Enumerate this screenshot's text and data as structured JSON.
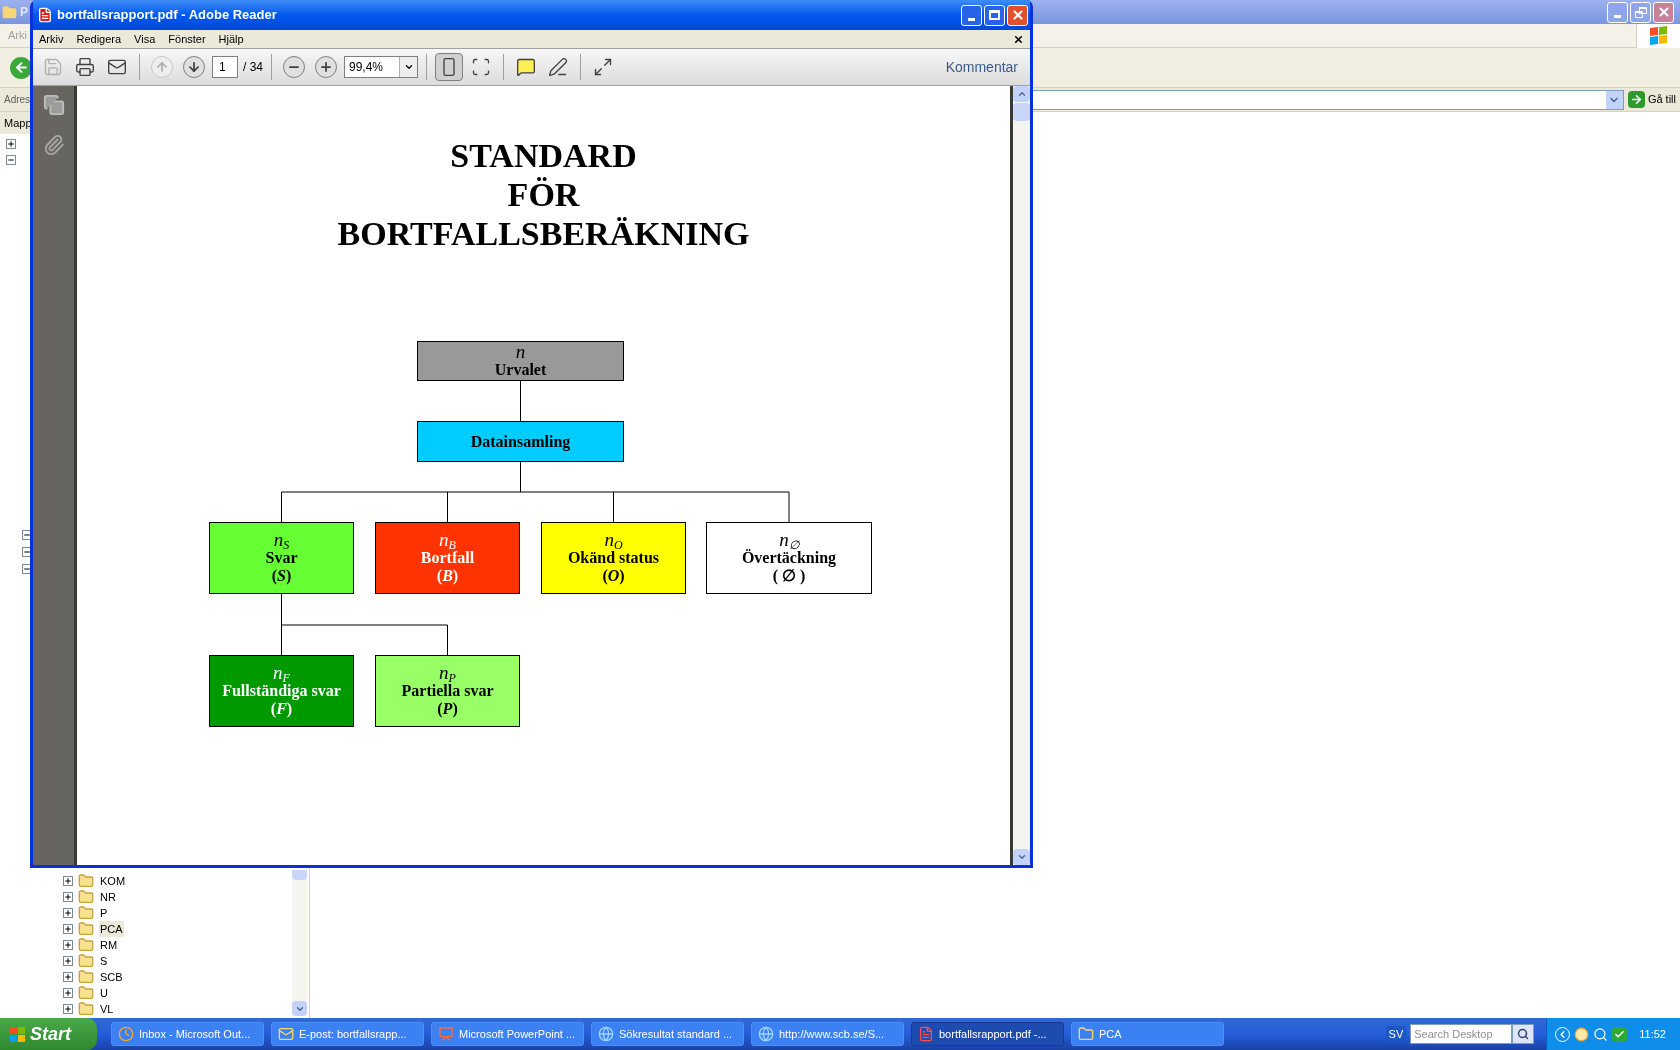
{
  "explorer": {
    "title": "P",
    "menu": [
      "Arki"
    ],
    "address_label": "Adres",
    "go_button": "Gå till",
    "folders_header": "Mapp",
    "folders": [
      {
        "name": "KOM",
        "selected": false
      },
      {
        "name": "NR",
        "selected": false
      },
      {
        "name": "P",
        "selected": false
      },
      {
        "name": "PCA",
        "selected": true
      },
      {
        "name": "RM",
        "selected": false
      },
      {
        "name": "S",
        "selected": false
      },
      {
        "name": "SCB",
        "selected": false
      },
      {
        "name": "U",
        "selected": false
      },
      {
        "name": "VL",
        "selected": false
      }
    ]
  },
  "reader": {
    "title": "bortfallsrapport.pdf - Adobe Reader",
    "menu": [
      "Arkiv",
      "Redigera",
      "Visa",
      "Fönster",
      "Hjälp"
    ],
    "tools": [
      {
        "kind": "save",
        "disabled": true,
        "pressed": false
      },
      {
        "kind": "print",
        "disabled": false,
        "pressed": false
      },
      {
        "kind": "email",
        "disabled": false,
        "pressed": false
      },
      {
        "kind": "separator"
      },
      {
        "kind": "page_up",
        "disabled": true,
        "pressed": false
      },
      {
        "kind": "page_down",
        "disabled": false,
        "pressed": false
      },
      {
        "kind": "page_field",
        "value": "1",
        "total": "/ 34"
      },
      {
        "kind": "separator"
      },
      {
        "kind": "zoom_out",
        "disabled": false,
        "pressed": false
      },
      {
        "kind": "zoom_in",
        "disabled": false,
        "pressed": false
      },
      {
        "kind": "zoom_field",
        "value": "99,4%"
      },
      {
        "kind": "separator"
      },
      {
        "kind": "fit_page",
        "disabled": false,
        "pressed": true
      },
      {
        "kind": "fit_width",
        "disabled": false,
        "pressed": false
      },
      {
        "kind": "separator"
      },
      {
        "kind": "comment",
        "disabled": false,
        "pressed": false
      },
      {
        "kind": "note",
        "disabled": false,
        "pressed": false
      },
      {
        "kind": "separator"
      },
      {
        "kind": "fullscreen",
        "disabled": false,
        "pressed": false
      }
    ],
    "comment_button": "Kommentar",
    "document": {
      "title_lines": [
        "STANDARD",
        "FÖR",
        "BORTFALLSBERÄKNING"
      ],
      "tree": {
        "symbol": "*n*",
        "label": "Urvalet",
        "color": "#999999",
        "children": [
          {
            "label": "Datainsamling",
            "color": "#00ccff",
            "children": [
              {
                "symbol": "*n*$_{S}$",
                "label": "Svar",
                "marker": "(*S*)",
                "color": "#66ff33",
                "children": [
                  {
                    "symbol": "*n*$_{F}$",
                    "label": "Fullständiga svar",
                    "marker": "(*F*)",
                    "color": "#009900"
                  },
                  {
                    "symbol": "*n*$_{P}$",
                    "label": "Partiella svar",
                    "marker": "(*P*)",
                    "color": "#99ff66"
                  }
                ]
              },
              {
                "symbol": "*n*$_{B}$",
                "label": "Bortfall",
                "marker": "(*B*)",
                "color": "#ff3300"
              },
              {
                "symbol": "*n*$_{O}$",
                "label": "Okänd status",
                "marker": "(*O*)",
                "color": "#ffff00"
              },
              {
                "symbol": "*n*$_{∅}$",
                "label": "Övertäckning",
                "marker": "( ∅ )",
                "color": "#ffffff"
              }
            ]
          }
        ]
      }
    }
  },
  "taskbar": {
    "start": "Start",
    "tasks": [
      {
        "label": "Inbox - Microsoft Out...",
        "kind": "outlook",
        "selected": false
      },
      {
        "label": "E-post: bortfallsrapp...",
        "kind": "mail",
        "selected": false
      },
      {
        "label": "Microsoft PowerPoint ...",
        "kind": "powerpoint",
        "selected": false
      },
      {
        "label": "Sökresultat standard ...",
        "kind": "browser",
        "selected": false
      },
      {
        "label": "http://www.scb.se/S...",
        "kind": "browser",
        "selected": false
      },
      {
        "label": "bortfallsrapport.pdf -...",
        "kind": "pdf",
        "selected": true
      },
      {
        "label": "PCA",
        "kind": "folder",
        "selected": false
      }
    ],
    "language": "SV",
    "search": {
      "placeholder": "Search Desktop"
    },
    "clock": "11:52"
  }
}
